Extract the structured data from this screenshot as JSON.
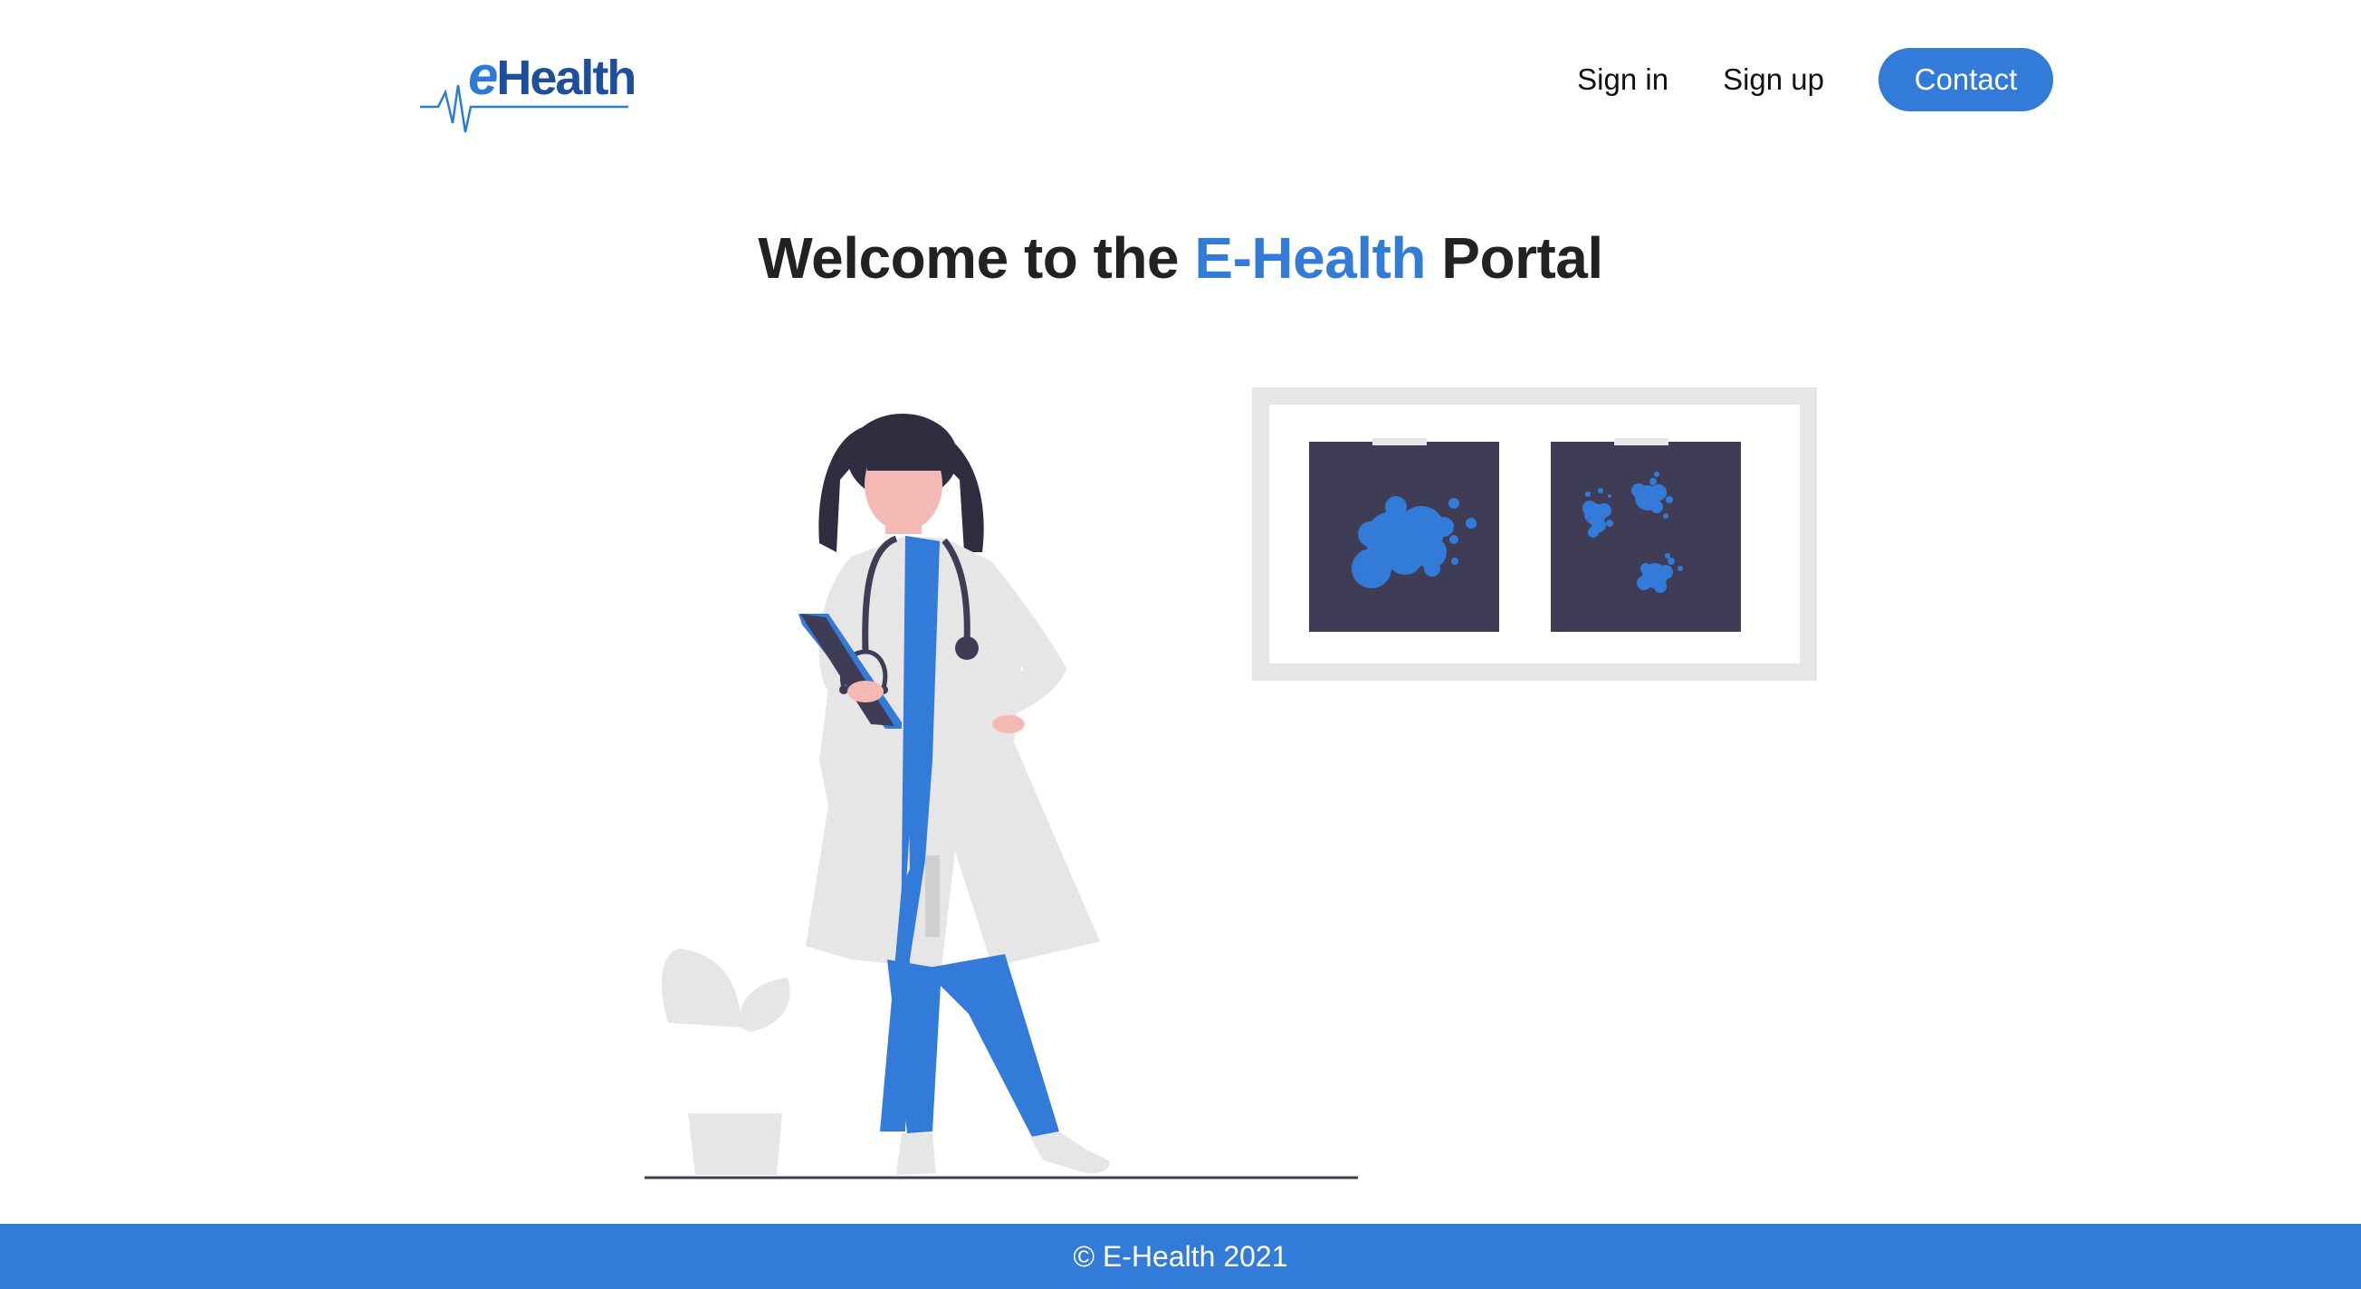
{
  "header": {
    "logo": {
      "prefix": "e",
      "name": "Health"
    },
    "nav": {
      "sign_in": "Sign in",
      "sign_up": "Sign up",
      "contact": "Contact"
    }
  },
  "hero": {
    "title_before": "Welcome to the ",
    "title_accent": "E-Health",
    "title_after": " Portal"
  },
  "footer": {
    "copyright": "© E-Health 2021"
  },
  "colors": {
    "accent": "#327bd9",
    "logo_dark": "#1e4f9c",
    "xray_dark": "#3f3d56",
    "coat": "#e6e6e6",
    "skin": "#f4b9b4"
  }
}
